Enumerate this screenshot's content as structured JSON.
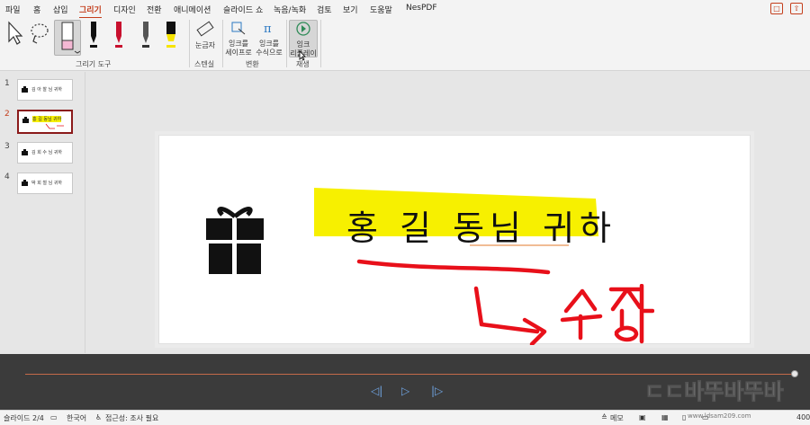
{
  "ribbon": {
    "tabs": [
      "파일",
      "홈",
      "삽입",
      "그리기",
      "디자인",
      "전환",
      "애니메이션",
      "슬라이드 쇼",
      "녹음/녹화",
      "검토",
      "보기",
      "도움말",
      "NesPDF"
    ],
    "active_tab": "그리기",
    "groups": {
      "drawing_tools": "그리기 도구",
      "stencils": "스텐실",
      "convert": "변환",
      "replay": "재생"
    },
    "buttons": {
      "ruler": "눈금자",
      "ink_to_shape_line1": "잉크를",
      "ink_to_shape_line2": "세이프로",
      "ink_to_math_line1": "잉크를",
      "ink_to_math_line2": "수식으로",
      "ink_replay_line1": "잉크",
      "ink_replay_line2": "리플레이"
    }
  },
  "slides_pane": {
    "items": [
      {
        "num": "1",
        "text": "김 아 찰 님 귀하"
      },
      {
        "num": "2",
        "text": "홍 길 동님 귀하"
      },
      {
        "num": "3",
        "text": "김 희 수 님 귀하"
      },
      {
        "num": "4",
        "text": "박 희 철 님 귀하"
      }
    ],
    "selected": "2"
  },
  "slide": {
    "text": "홍 길 동님 귀하",
    "ink_annotation": "수정"
  },
  "status_bar": {
    "slide_counter": "슬라이드 2/4",
    "language": "한국어",
    "accessibility": "접근성: 조사 필요",
    "notes": "메모",
    "zoom": "400%"
  },
  "watermark": {
    "text": "ㄷㄷ바뚜바뚜바",
    "url": "www.ldsam209.com"
  },
  "colors": {
    "accent": "#c43e1c",
    "highlight": "#f7f000",
    "ink_red": "#e8101a",
    "playbar": "#3b3b3b"
  }
}
